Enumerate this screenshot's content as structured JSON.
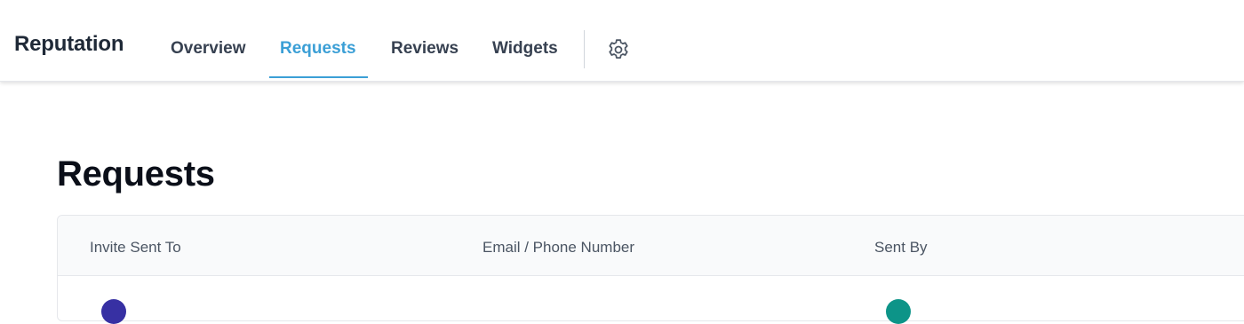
{
  "app": {
    "title": "Reputation"
  },
  "nav": {
    "tabs": [
      {
        "label": "Overview",
        "active": false
      },
      {
        "label": "Requests",
        "active": true
      },
      {
        "label": "Reviews",
        "active": false
      },
      {
        "label": "Widgets",
        "active": false
      }
    ],
    "settings_icon": "gear-icon"
  },
  "page": {
    "title": "Requests"
  },
  "table": {
    "columns": [
      "Invite Sent To",
      "Email / Phone Number",
      "Sent By"
    ]
  },
  "colors": {
    "accent": "#3b9fd6",
    "avatar_invite": "#3730a3",
    "avatar_sender": "#0d9488"
  }
}
